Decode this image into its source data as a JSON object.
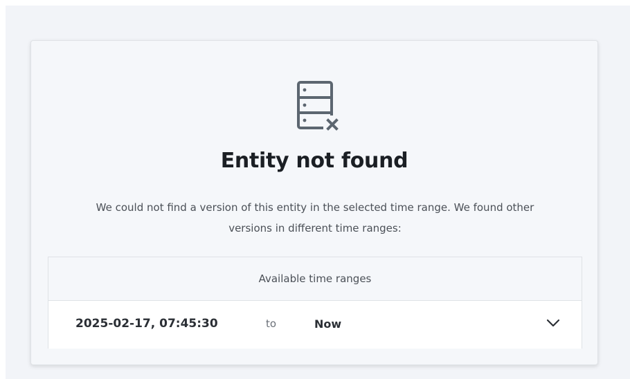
{
  "empty_state": {
    "icon": "server-not-found-icon",
    "title": "Entity not found",
    "description": "We could not find a version of this entity in the selected time range. We found other versions in different time ranges:"
  },
  "time_ranges": {
    "header": "Available time ranges",
    "items": [
      {
        "start": "2025-02-17, 07:45:30",
        "separator": "to",
        "end": "Now"
      }
    ],
    "expand_icon": "chevron-down-icon"
  },
  "colors": {
    "icon": "#5c6670",
    "title": "#1b1f24",
    "text": "#4b5057",
    "border": "#dfe2e6",
    "card_bg": "#f5f7fa"
  }
}
